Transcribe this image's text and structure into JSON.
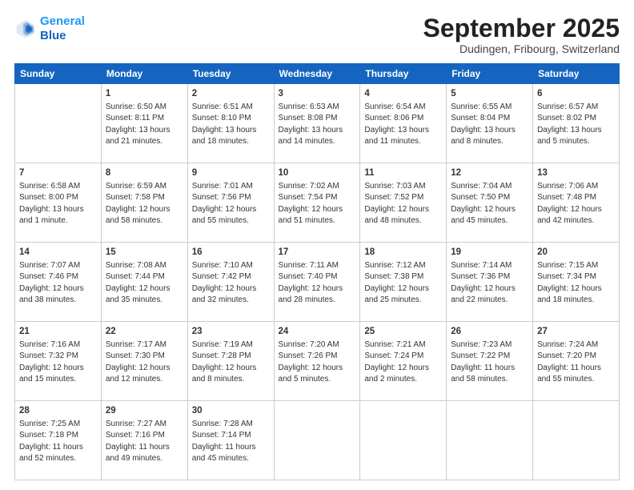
{
  "logo": {
    "line1": "General",
    "line2": "Blue"
  },
  "header": {
    "title": "September 2025",
    "location": "Dudingen, Fribourg, Switzerland"
  },
  "weekdays": [
    "Sunday",
    "Monday",
    "Tuesday",
    "Wednesday",
    "Thursday",
    "Friday",
    "Saturday"
  ],
  "weeks": [
    [
      {
        "day": "",
        "info": ""
      },
      {
        "day": "1",
        "info": "Sunrise: 6:50 AM\nSunset: 8:11 PM\nDaylight: 13 hours\nand 21 minutes."
      },
      {
        "day": "2",
        "info": "Sunrise: 6:51 AM\nSunset: 8:10 PM\nDaylight: 13 hours\nand 18 minutes."
      },
      {
        "day": "3",
        "info": "Sunrise: 6:53 AM\nSunset: 8:08 PM\nDaylight: 13 hours\nand 14 minutes."
      },
      {
        "day": "4",
        "info": "Sunrise: 6:54 AM\nSunset: 8:06 PM\nDaylight: 13 hours\nand 11 minutes."
      },
      {
        "day": "5",
        "info": "Sunrise: 6:55 AM\nSunset: 8:04 PM\nDaylight: 13 hours\nand 8 minutes."
      },
      {
        "day": "6",
        "info": "Sunrise: 6:57 AM\nSunset: 8:02 PM\nDaylight: 13 hours\nand 5 minutes."
      }
    ],
    [
      {
        "day": "7",
        "info": "Sunrise: 6:58 AM\nSunset: 8:00 PM\nDaylight: 13 hours\nand 1 minute."
      },
      {
        "day": "8",
        "info": "Sunrise: 6:59 AM\nSunset: 7:58 PM\nDaylight: 12 hours\nand 58 minutes."
      },
      {
        "day": "9",
        "info": "Sunrise: 7:01 AM\nSunset: 7:56 PM\nDaylight: 12 hours\nand 55 minutes."
      },
      {
        "day": "10",
        "info": "Sunrise: 7:02 AM\nSunset: 7:54 PM\nDaylight: 12 hours\nand 51 minutes."
      },
      {
        "day": "11",
        "info": "Sunrise: 7:03 AM\nSunset: 7:52 PM\nDaylight: 12 hours\nand 48 minutes."
      },
      {
        "day": "12",
        "info": "Sunrise: 7:04 AM\nSunset: 7:50 PM\nDaylight: 12 hours\nand 45 minutes."
      },
      {
        "day": "13",
        "info": "Sunrise: 7:06 AM\nSunset: 7:48 PM\nDaylight: 12 hours\nand 42 minutes."
      }
    ],
    [
      {
        "day": "14",
        "info": "Sunrise: 7:07 AM\nSunset: 7:46 PM\nDaylight: 12 hours\nand 38 minutes."
      },
      {
        "day": "15",
        "info": "Sunrise: 7:08 AM\nSunset: 7:44 PM\nDaylight: 12 hours\nand 35 minutes."
      },
      {
        "day": "16",
        "info": "Sunrise: 7:10 AM\nSunset: 7:42 PM\nDaylight: 12 hours\nand 32 minutes."
      },
      {
        "day": "17",
        "info": "Sunrise: 7:11 AM\nSunset: 7:40 PM\nDaylight: 12 hours\nand 28 minutes."
      },
      {
        "day": "18",
        "info": "Sunrise: 7:12 AM\nSunset: 7:38 PM\nDaylight: 12 hours\nand 25 minutes."
      },
      {
        "day": "19",
        "info": "Sunrise: 7:14 AM\nSunset: 7:36 PM\nDaylight: 12 hours\nand 22 minutes."
      },
      {
        "day": "20",
        "info": "Sunrise: 7:15 AM\nSunset: 7:34 PM\nDaylight: 12 hours\nand 18 minutes."
      }
    ],
    [
      {
        "day": "21",
        "info": "Sunrise: 7:16 AM\nSunset: 7:32 PM\nDaylight: 12 hours\nand 15 minutes."
      },
      {
        "day": "22",
        "info": "Sunrise: 7:17 AM\nSunset: 7:30 PM\nDaylight: 12 hours\nand 12 minutes."
      },
      {
        "day": "23",
        "info": "Sunrise: 7:19 AM\nSunset: 7:28 PM\nDaylight: 12 hours\nand 8 minutes."
      },
      {
        "day": "24",
        "info": "Sunrise: 7:20 AM\nSunset: 7:26 PM\nDaylight: 12 hours\nand 5 minutes."
      },
      {
        "day": "25",
        "info": "Sunrise: 7:21 AM\nSunset: 7:24 PM\nDaylight: 12 hours\nand 2 minutes."
      },
      {
        "day": "26",
        "info": "Sunrise: 7:23 AM\nSunset: 7:22 PM\nDaylight: 11 hours\nand 58 minutes."
      },
      {
        "day": "27",
        "info": "Sunrise: 7:24 AM\nSunset: 7:20 PM\nDaylight: 11 hours\nand 55 minutes."
      }
    ],
    [
      {
        "day": "28",
        "info": "Sunrise: 7:25 AM\nSunset: 7:18 PM\nDaylight: 11 hours\nand 52 minutes."
      },
      {
        "day": "29",
        "info": "Sunrise: 7:27 AM\nSunset: 7:16 PM\nDaylight: 11 hours\nand 49 minutes."
      },
      {
        "day": "30",
        "info": "Sunrise: 7:28 AM\nSunset: 7:14 PM\nDaylight: 11 hours\nand 45 minutes."
      },
      {
        "day": "",
        "info": ""
      },
      {
        "day": "",
        "info": ""
      },
      {
        "day": "",
        "info": ""
      },
      {
        "day": "",
        "info": ""
      }
    ]
  ]
}
